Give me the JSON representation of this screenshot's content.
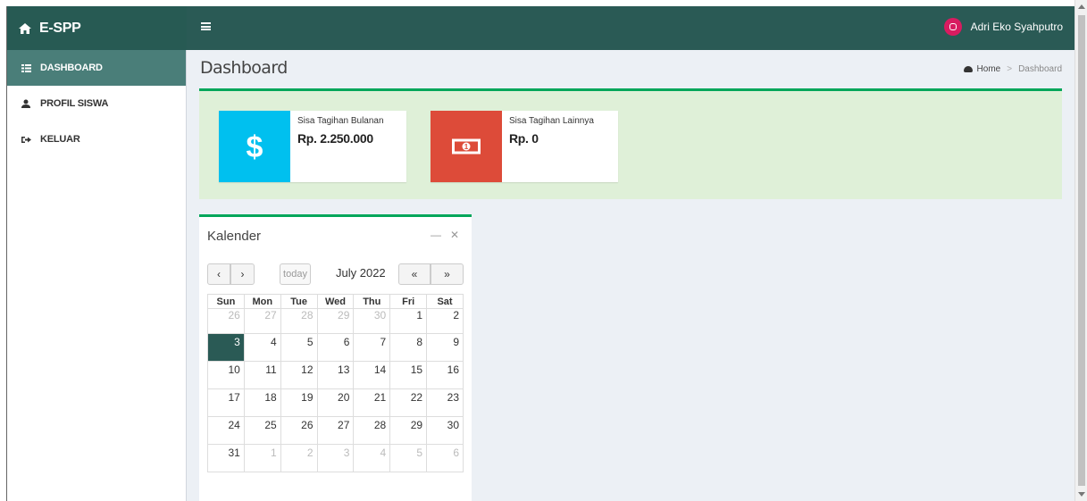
{
  "app": {
    "title": "E-SPP"
  },
  "user": {
    "name": "Adri Eko Syahputro"
  },
  "sidebar": {
    "items": [
      {
        "label": "DASHBOARD"
      },
      {
        "label": "PROFIL SISWA"
      },
      {
        "label": "KELUAR"
      }
    ]
  },
  "page": {
    "title": "Dashboard"
  },
  "breadcrumb": {
    "home": "Home",
    "sep": ">",
    "current": "Dashboard"
  },
  "cards": [
    {
      "label": "Sisa Tagihan Bulanan",
      "value": "Rp. 2.250.000",
      "color": "#00c0ef",
      "icon": "dollar-icon"
    },
    {
      "label": "Sisa Tagihan Lainnya",
      "value": "Rp. 0",
      "color": "#dd4b39",
      "icon": "money-icon"
    }
  ],
  "calendar": {
    "title": "Kalender",
    "today_label": "today",
    "month": "July 2022",
    "weekdays": [
      "Sun",
      "Mon",
      "Tue",
      "Wed",
      "Thu",
      "Fri",
      "Sat"
    ],
    "weeks": [
      [
        "26",
        "27",
        "28",
        "29",
        "30",
        "1",
        "2"
      ],
      [
        "3",
        "4",
        "5",
        "6",
        "7",
        "8",
        "9"
      ],
      [
        "10",
        "11",
        "12",
        "13",
        "14",
        "15",
        "16"
      ],
      [
        "17",
        "18",
        "19",
        "20",
        "21",
        "22",
        "23"
      ],
      [
        "24",
        "25",
        "26",
        "27",
        "28",
        "29",
        "30"
      ],
      [
        "31",
        "1",
        "2",
        "3",
        "4",
        "5",
        "6"
      ]
    ]
  },
  "colors": {
    "nav": "#2a5a55",
    "accent": "#00a65a",
    "today": "#2a5a55"
  }
}
